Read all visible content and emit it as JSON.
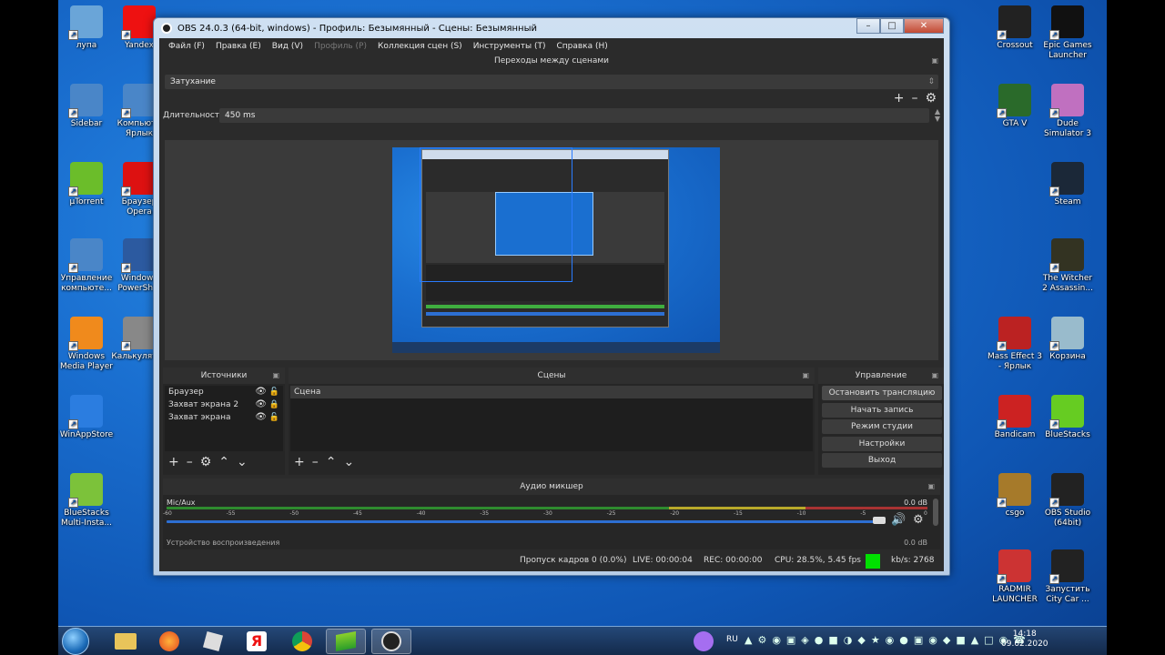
{
  "desktop": {
    "left_icons": [
      {
        "label": "лупа"
      },
      {
        "label": "Yandex"
      },
      {
        "label": "Sidebar"
      },
      {
        "label": "Компьют - Ярлык"
      },
      {
        "label": "µTorrent"
      },
      {
        "label": "Браузер Opera"
      },
      {
        "label": "Управление компьюте..."
      },
      {
        "label": "Windows PowerSh..."
      },
      {
        "label": "Windows Media Player"
      },
      {
        "label": "Калькулятор"
      },
      {
        "label": "WinAppStore"
      },
      {
        "label": "BlueStacks Multi-Insta..."
      }
    ],
    "right_icons": [
      {
        "label": "Crossout"
      },
      {
        "label": "Epic Games Launcher"
      },
      {
        "label": "GTA V"
      },
      {
        "label": "Dude Simulator 3"
      },
      {
        "label": "Steam"
      },
      {
        "label": "The Witcher 2 Assassin..."
      },
      {
        "label": "Mass Effect 3 - Ярлык"
      },
      {
        "label": "Корзина"
      },
      {
        "label": "Bandicam"
      },
      {
        "label": "BlueStacks"
      },
      {
        "label": "csgo"
      },
      {
        "label": "OBS Studio (64bit)"
      },
      {
        "label": "RADMIR LAUNCHER"
      },
      {
        "label": "Запустить City Car ..."
      }
    ]
  },
  "obs": {
    "title": "OBS 24.0.3 (64-bit, windows) - Профиль: Безымянный - Сцены: Безымянный",
    "menu": [
      "Файл (F)",
      "Правка (E)",
      "Вид (V)",
      "Профиль (P)",
      "Коллекция сцен (S)",
      "Инструменты (T)",
      "Справка (H)"
    ],
    "transitions": {
      "header": "Переходы между сценами",
      "selected": "Затухание",
      "duration_label": "Длительность",
      "duration_value": "450 ms"
    },
    "sources": {
      "header": "Источники",
      "items": [
        "Браузер",
        "Захват экрана 2",
        "Захват экрана"
      ]
    },
    "scenes": {
      "header": "Сцены",
      "items": [
        "Сцена"
      ]
    },
    "controls": {
      "header": "Управление",
      "buttons": [
        "Остановить трансляцию",
        "Начать запись",
        "Режим студии",
        "Настройки",
        "Выход"
      ]
    },
    "mixer": {
      "header": "Аудио микшер",
      "channel": "Mic/Aux",
      "db": "0.0 dB",
      "ticks": [
        "-60",
        "-55",
        "-50",
        "-45",
        "-40",
        "-35",
        "-30",
        "-25",
        "-20",
        "-15",
        "-10",
        "-5",
        "0"
      ],
      "next_channel": "Устройство воспроизведения",
      "next_db": "0.0 dB"
    },
    "status": {
      "dropped": "Пропуск кадров 0 (0.0%)",
      "live": "LIVE: 00:00:04",
      "rec": "REC: 00:00:00",
      "cpu": "CPU: 28.5%, 5.45 fps",
      "kbps": "kb/s: 2768",
      "indicator_color": "#00e000"
    }
  },
  "taskbar": {
    "lang": "RU",
    "time": "14:18",
    "date": "09.02.2020"
  }
}
